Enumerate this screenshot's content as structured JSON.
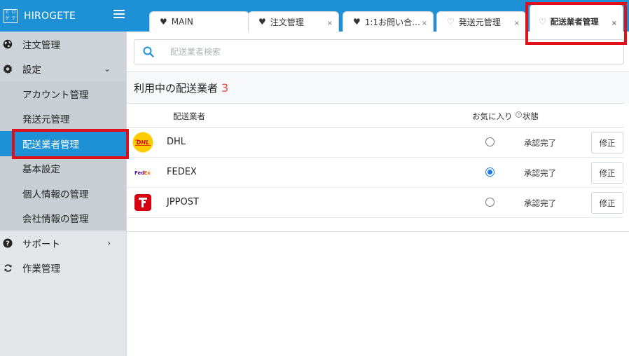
{
  "app": {
    "brand": "HIROGETE",
    "logo_chars": [
      "ヒ",
      "ロ",
      "ゲ",
      "テ"
    ]
  },
  "tabs": [
    {
      "label": "MAIN",
      "icon": "heart-filled-icon",
      "closable": false
    },
    {
      "label": "注文管理",
      "icon": "heart-filled-icon",
      "closable": true
    },
    {
      "label": "1:1お問い合…",
      "icon": "heart-filled-icon",
      "closable": true
    },
    {
      "label": "発送元管理",
      "icon": "heart-outline-icon",
      "closable": true
    },
    {
      "label": "配送業者管理",
      "icon": "heart-outline-icon",
      "closable": true,
      "active": true
    }
  ],
  "close_glyph": "×",
  "sidebar": {
    "items": [
      {
        "label": "注文管理",
        "icon": "globe-icon"
      },
      {
        "label": "設定",
        "icon": "gear-icon",
        "expanded": true
      },
      {
        "label": "アカウント管理"
      },
      {
        "label": "発送元管理"
      },
      {
        "label": "配送業者管理",
        "active": true
      },
      {
        "label": "基本設定"
      },
      {
        "label": "個人情報の管理"
      },
      {
        "label": "会社情報の管理"
      },
      {
        "label": "サポート",
        "icon": "question-circle-icon"
      },
      {
        "label": "作業管理",
        "icon": "refresh-icon"
      }
    ]
  },
  "search": {
    "placeholder": "配送業者検索"
  },
  "panel": {
    "title": "利用中の配送業者",
    "count": "3"
  },
  "table": {
    "headers": {
      "carrier": "配送業者",
      "favorite": "お気に入り",
      "status": "状態"
    },
    "rows": [
      {
        "name": "DHL",
        "logo": "dhl-logo",
        "favorite": false,
        "status": "承認完了",
        "action": "修正"
      },
      {
        "name": "FEDEX",
        "logo": "fedex-logo",
        "favorite": true,
        "status": "承認完了",
        "action": "修正"
      },
      {
        "name": "JPPOST",
        "logo": "jppost-logo",
        "favorite": false,
        "status": "承認完了",
        "action": "修正"
      }
    ]
  },
  "colors": {
    "accent": "#1e90d6",
    "highlight": "#e0101a",
    "count": "#e74c3c"
  }
}
